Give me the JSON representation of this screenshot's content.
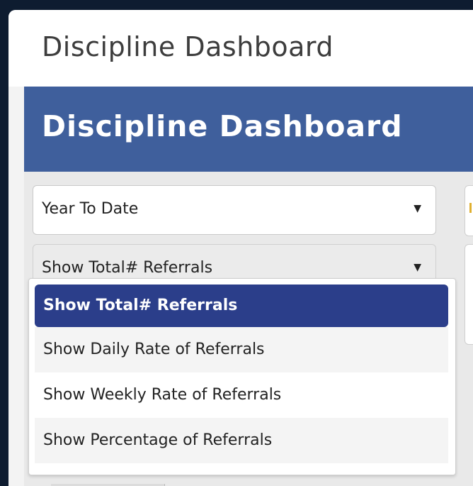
{
  "window": {
    "title": "Discipline Dashboard"
  },
  "banner": {
    "title": "Discipline Dashboard"
  },
  "filters": {
    "date_range": {
      "selected": "Year To Date"
    },
    "metric": {
      "selected": "Show Total# Referrals"
    }
  },
  "dropdown": {
    "options": [
      "Show Total# Referrals",
      "Show Daily Rate of Referrals",
      "Show Weekly Rate of Referrals",
      "Show Percentage of Referrals"
    ],
    "selected_index": 0
  },
  "colors": {
    "banner": "#3f5f9c",
    "selected_option": "#2b3e8a",
    "frame": "#0e1c30"
  }
}
